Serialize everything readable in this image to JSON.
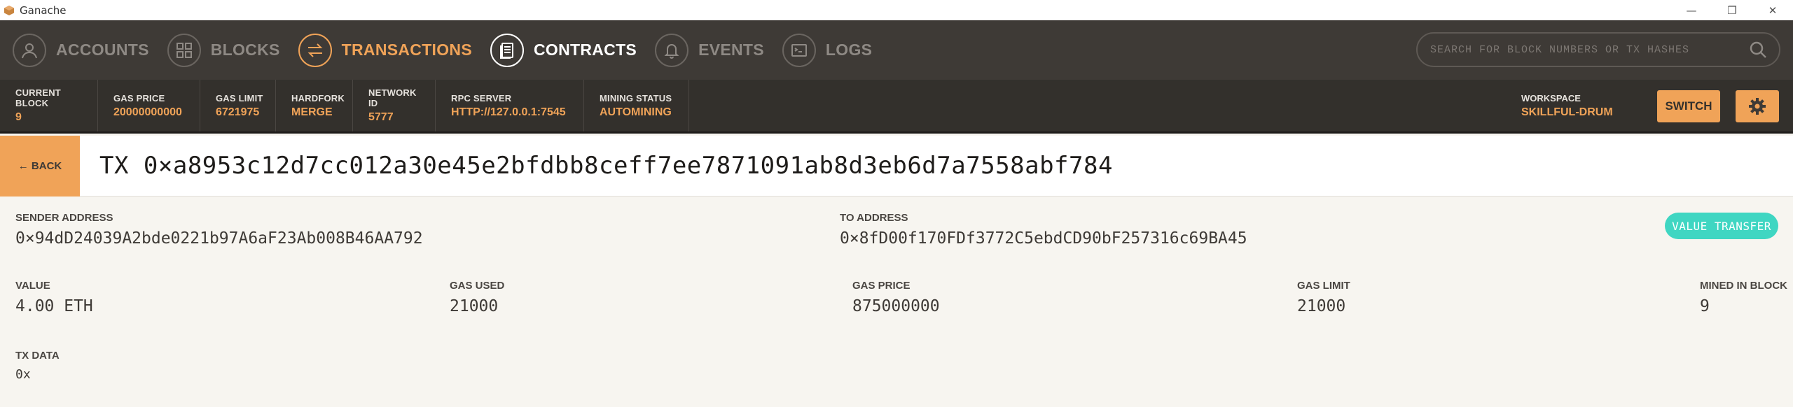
{
  "window": {
    "title": "Ganache",
    "controls": [
      "—",
      "❐",
      "✕"
    ]
  },
  "nav": {
    "items": [
      {
        "label": "ACCOUNTS",
        "icon": "account-icon",
        "state": "inactive"
      },
      {
        "label": "BLOCKS",
        "icon": "blocks-icon",
        "state": "inactive"
      },
      {
        "label": "TRANSACTIONS",
        "icon": "transactions-icon",
        "state": "active"
      },
      {
        "label": "CONTRACTS",
        "icon": "contracts-icon",
        "state": "highlight"
      },
      {
        "label": "EVENTS",
        "icon": "bell-icon",
        "state": "inactive"
      },
      {
        "label": "LOGS",
        "icon": "terminal-icon",
        "state": "inactive"
      }
    ],
    "search_placeholder": "SEARCH FOR BLOCK NUMBERS OR TX HASHES"
  },
  "status": {
    "current_block": {
      "label": "CURRENT BLOCK",
      "value": "9"
    },
    "gas_price": {
      "label": "GAS PRICE",
      "value": "20000000000"
    },
    "gas_limit": {
      "label": "GAS LIMIT",
      "value": "6721975"
    },
    "hardfork": {
      "label": "HARDFORK",
      "value": "MERGE"
    },
    "network_id": {
      "label": "NETWORK ID",
      "value": "5777"
    },
    "rpc_server": {
      "label": "RPC SERVER",
      "value": "HTTP://127.0.0.1:7545"
    },
    "mining_status": {
      "label": "MINING STATUS",
      "value": "AUTOMINING"
    },
    "workspace": {
      "label": "WORKSPACE",
      "value": "SKILLFUL-DRUM"
    },
    "switch_label": "SWITCH"
  },
  "tx": {
    "back_label": "← BACK",
    "title": "TX 0×a8953c12d7cc012a30e45e2bfdbb8ceff7ee7871091ab8d3eb6d7a7558abf784",
    "badge": "VALUE TRANSFER",
    "sender": {
      "label": "SENDER ADDRESS",
      "value": "0×94dD24039A2bde0221b97A6aF23Ab008B46AA792"
    },
    "to": {
      "label": "TO ADDRESS",
      "value": "0×8fD00f170FDf3772C5ebdCD90bF257316c69BA45"
    },
    "value": {
      "label": "VALUE",
      "value": "4.00 ETH"
    },
    "gas_used": {
      "label": "GAS USED",
      "value": "21000"
    },
    "gas_price": {
      "label": "GAS PRICE",
      "value": "875000000"
    },
    "gas_limit": {
      "label": "GAS LIMIT",
      "value": "21000"
    },
    "mined_in_block": {
      "label": "MINED IN BLOCK",
      "value": "9"
    },
    "tx_data": {
      "label": "TX DATA",
      "value": "0x"
    }
  },
  "colors": {
    "accent": "#f0a358",
    "nav_bg": "#3e3a36",
    "status_bg": "#33302c",
    "badge": "#3fd6c2",
    "page_bg": "#f7f5f0"
  }
}
